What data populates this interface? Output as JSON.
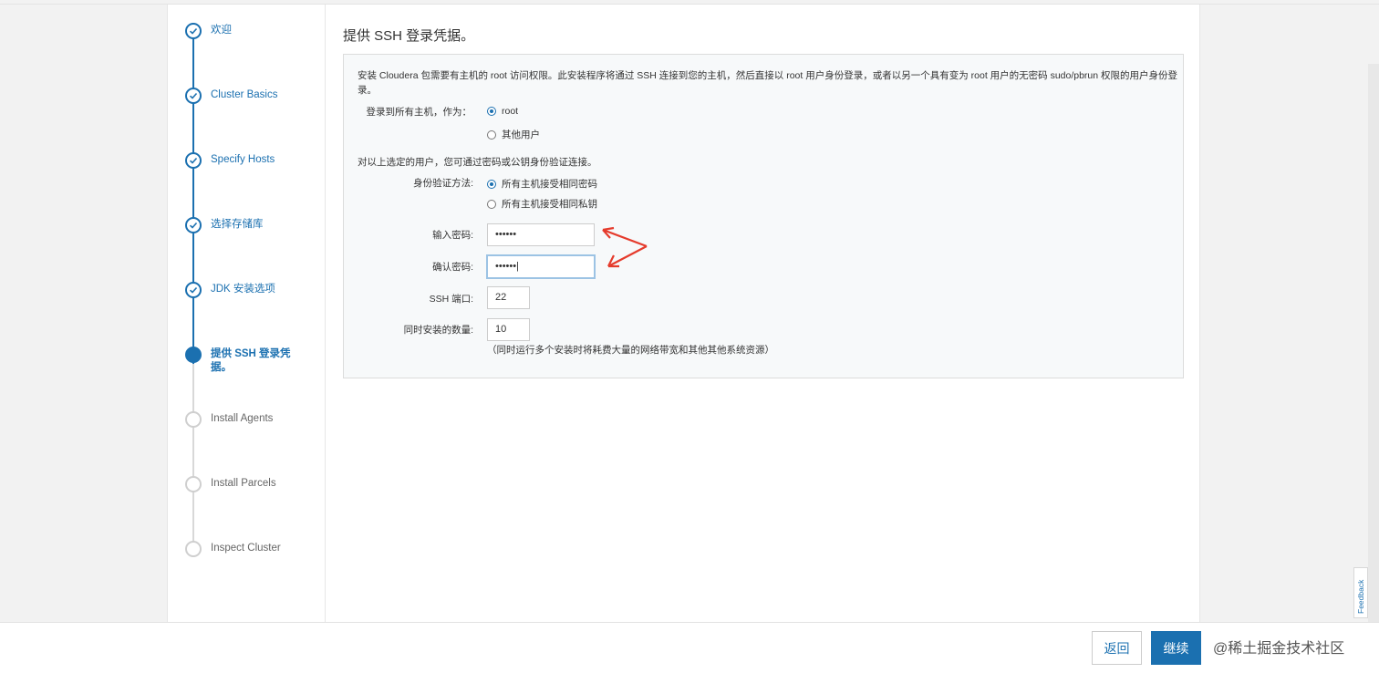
{
  "sidebar": {
    "steps": [
      {
        "label": "欢迎",
        "state": "done"
      },
      {
        "label": "Cluster Basics",
        "state": "done"
      },
      {
        "label": "Specify Hosts",
        "state": "done"
      },
      {
        "label": "选择存储库",
        "state": "done"
      },
      {
        "label": "JDK 安装选项",
        "state": "done"
      },
      {
        "label": "提供 SSH 登录凭据。",
        "state": "active"
      },
      {
        "label": "Install Agents",
        "state": "pending"
      },
      {
        "label": "Install Parcels",
        "state": "pending"
      },
      {
        "label": "Inspect Cluster",
        "state": "pending"
      }
    ]
  },
  "main": {
    "title": "提供 SSH 登录凭据。",
    "intro": "安装 Cloudera 包需要有主机的 root 访问权限。此安装程序将通过 SSH 连接到您的主机，然后直接以 root 用户身份登录，或者以另一个具有变为 root 用户的无密码 sudo/pbrun 权限的用户身份登录。",
    "login_as_label": "登录到所有主机，作为：",
    "login_options": [
      "root",
      "其他用户"
    ],
    "auth_note": "对以上选定的用户，您可通过密码或公钥身份验证连接。",
    "auth_method_label": "身份验证方法:",
    "auth_options": [
      "所有主机接受相同密码",
      "所有主机接受相同私钥"
    ],
    "password_label": "输入密码:",
    "password_value": "••••••",
    "confirm_label": "确认密码:",
    "confirm_value": "••••••|",
    "ssh_port_label": "SSH 端口:",
    "ssh_port_value": "22",
    "concurrent_label": "同时安装的数量:",
    "concurrent_value": "10",
    "concurrent_note": "（同时运行多个安装时将耗费大量的网络带宽和其他其他系统资源）"
  },
  "footer": {
    "back_label": "返回",
    "next_label": "继续",
    "watermark": "@稀土掘金技术社区"
  },
  "feedback_label": "Feedback",
  "colors": {
    "accent": "#1b70b0",
    "arrow": "#e53b2c"
  }
}
